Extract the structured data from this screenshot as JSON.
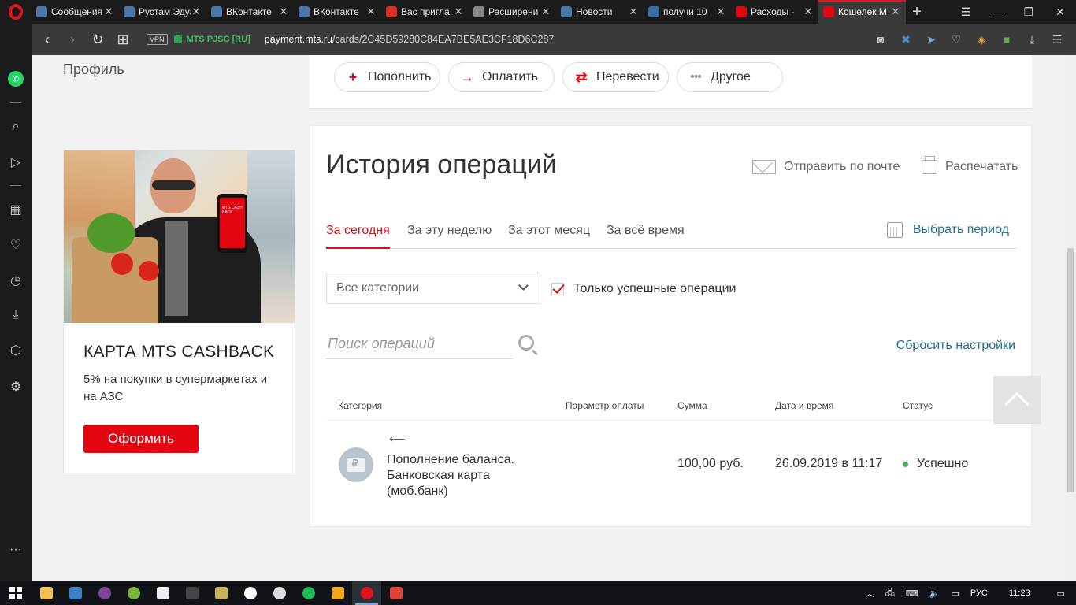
{
  "browser": {
    "tabs": [
      {
        "title": "Сообщения",
        "color": "#4a76a8",
        "glyph": "✉"
      },
      {
        "title": "Рустам Эдуа",
        "color": "#4a76a8",
        "glyph": "vk"
      },
      {
        "title": "ВКонтакте",
        "color": "#4a76a8",
        "glyph": "vk"
      },
      {
        "title": "ВКонтакте",
        "color": "#4a76a8",
        "glyph": "vk"
      },
      {
        "title": "Вас пригла",
        "color": "#d93025",
        "glyph": "M"
      },
      {
        "title": "Расширени",
        "color": "#888888",
        "glyph": "◆"
      },
      {
        "title": "Новости",
        "color": "#4a76a8",
        "glyph": "vk"
      },
      {
        "title": "получи 10",
        "color": "#3b6ea5",
        "glyph": "☺"
      },
      {
        "title": "Расходы -",
        "color": "#e30611",
        "glyph": "●"
      },
      {
        "title": "Кошелек М",
        "color": "#e30611",
        "glyph": "●",
        "active": true
      }
    ],
    "address": {
      "vpn": "VPN",
      "site_id": "MTS PJSC [RU]",
      "url_host": "payment.mts.ru",
      "url_path": "/cards/2C45D59280C84EA7BE5AE3CF18D6C287"
    }
  },
  "page": {
    "profile_link": "Профиль",
    "actions": {
      "topup": "Пополнить",
      "pay": "Оплатить",
      "transfer": "Перевести",
      "other": "Другое"
    },
    "promo": {
      "phone_text": "MTS CASH BACK",
      "title": "КАРТА MTS CASHBACK",
      "text": "5% на покупки в супермаркетах и на АЗС",
      "button": "Оформить"
    },
    "history": {
      "title": "История операций",
      "send_mail": "Отправить по почте",
      "print": "Распечатать",
      "tabs": [
        "За сегодня",
        "За эту неделю",
        "За этот месяц",
        "За всё время"
      ],
      "active_tab": "За сегодня",
      "period": "Выбрать период",
      "category_select": "Все категории",
      "only_success": "Только успешные операции",
      "only_success_checked": true,
      "search_placeholder": "Поиск операций",
      "reset": "Сбросить настройки",
      "columns": {
        "category": "Категория",
        "param": "Параметр оплаты",
        "sum": "Сумма",
        "datetime": "Дата и время",
        "status": "Статус"
      },
      "rows": [
        {
          "name": "Пополнение баланса. Банковская карта (моб.банк)",
          "sum": "100,00 руб.",
          "datetime": "26.09.2019 в 11:17",
          "status": "Успешно",
          "status_color": "#4caf50"
        }
      ]
    }
  },
  "taskbar": {
    "lang": "РУС",
    "time": "11:23"
  }
}
